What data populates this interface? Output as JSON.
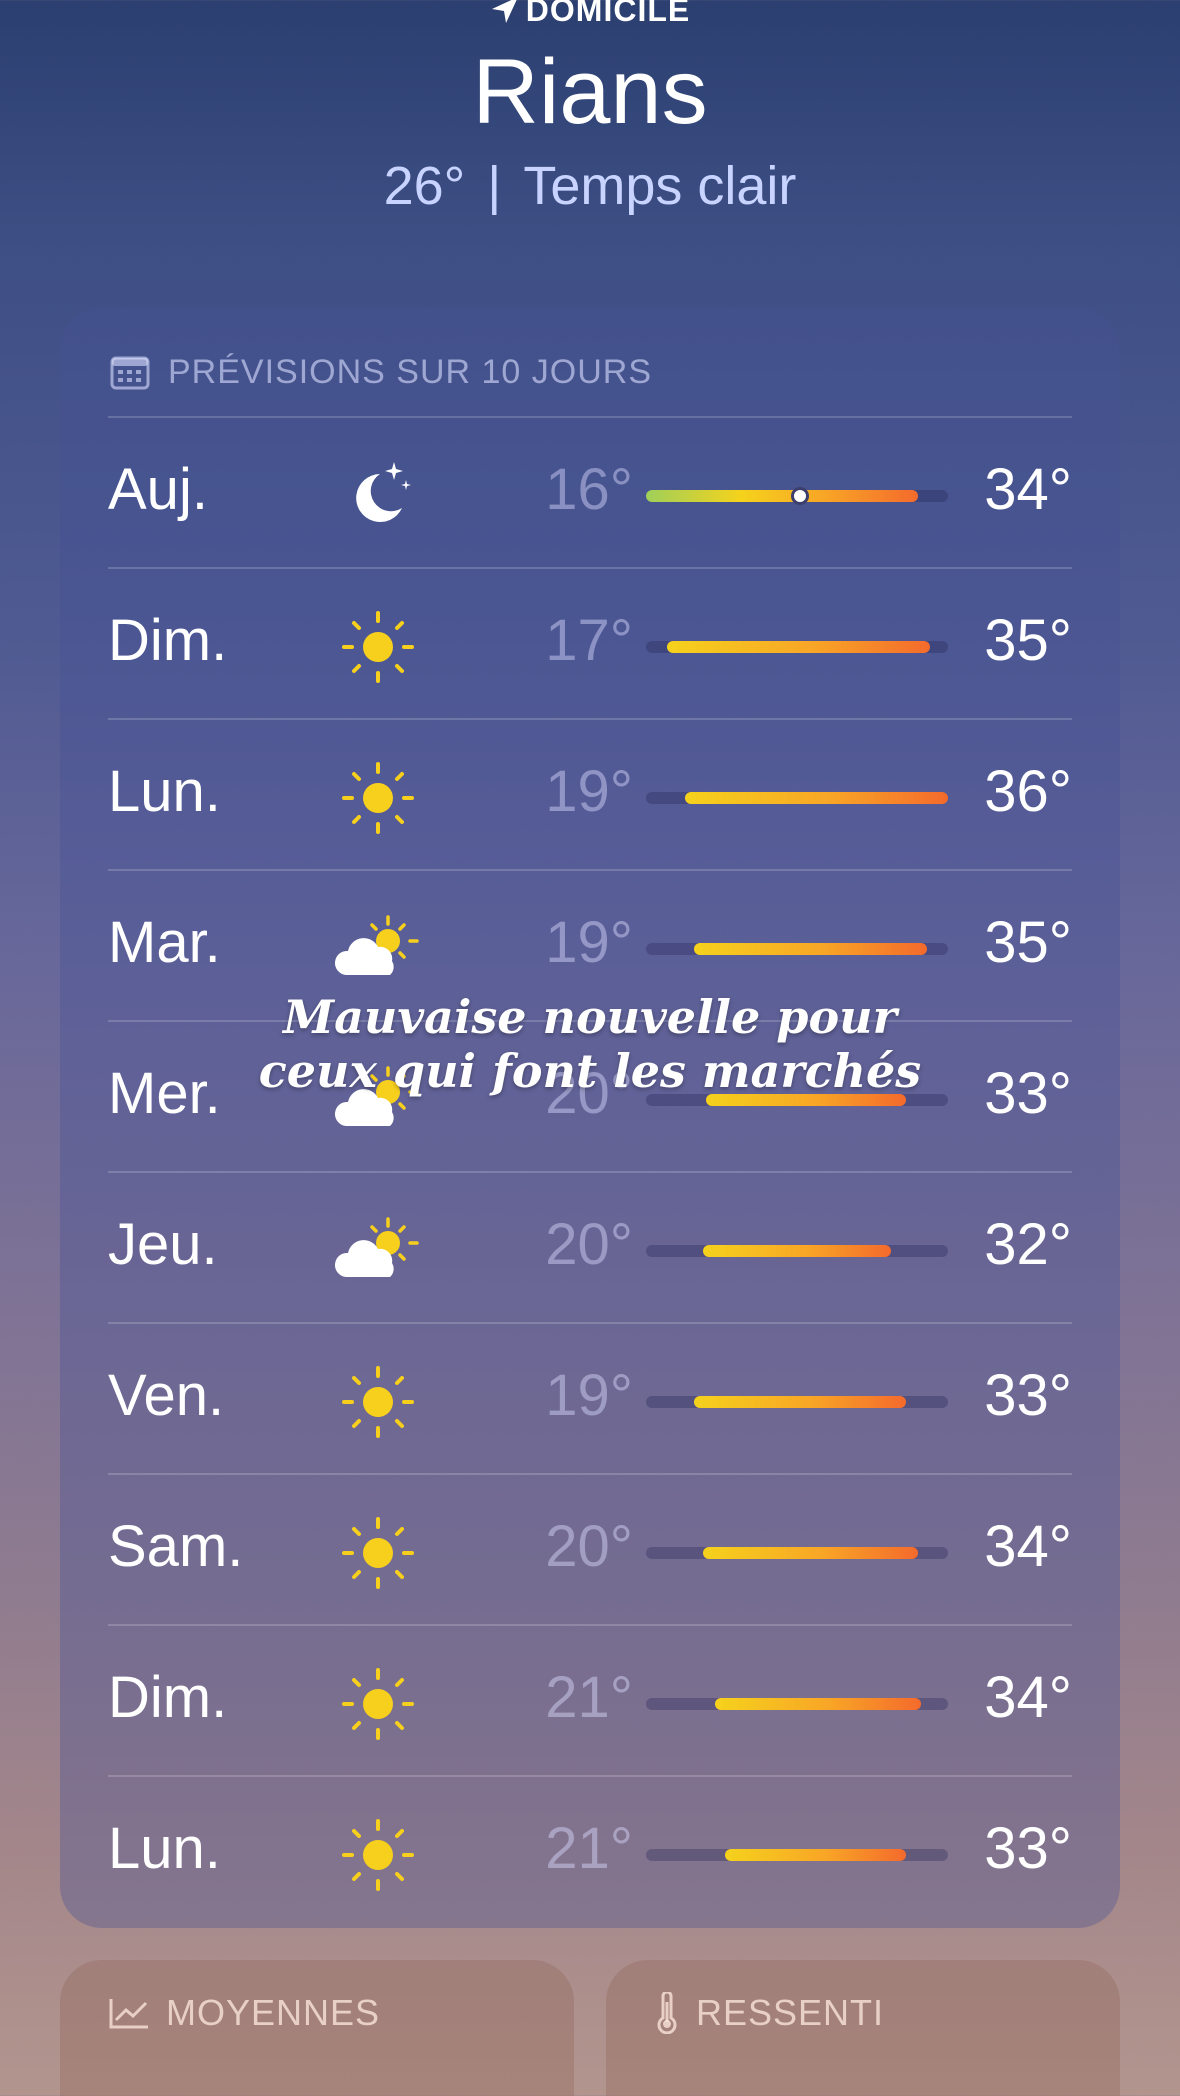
{
  "header": {
    "location_label": "DOMICILE",
    "city": "Rians",
    "current_temp": "26°",
    "separator": "|",
    "condition": "Temps clair"
  },
  "forecast": {
    "title": "PRÉVISIONS SUR 10 JOURS",
    "days": [
      {
        "day": "Auj.",
        "icon": "moon-stars-icon",
        "low": "16°",
        "high": "34°",
        "bar_start": 0.0,
        "bar_end": 0.9,
        "current_pos": 0.51
      },
      {
        "day": "Dim.",
        "icon": "sun-icon",
        "low": "17°",
        "high": "35°",
        "bar_start": 0.07,
        "bar_end": 0.94
      },
      {
        "day": "Lun.",
        "icon": "sun-icon",
        "low": "19°",
        "high": "36°",
        "bar_start": 0.13,
        "bar_end": 1.0
      },
      {
        "day": "Mar.",
        "icon": "partly-cloudy-icon",
        "low": "19°",
        "high": "35°",
        "bar_start": 0.16,
        "bar_end": 0.93
      },
      {
        "day": "Mer.",
        "icon": "partly-cloudy-icon",
        "low": "20°",
        "high": "33°",
        "bar_start": 0.2,
        "bar_end": 0.86
      },
      {
        "day": "Jeu.",
        "icon": "partly-cloudy-icon",
        "low": "20°",
        "high": "32°",
        "bar_start": 0.19,
        "bar_end": 0.81
      },
      {
        "day": "Ven.",
        "icon": "sun-icon",
        "low": "19°",
        "high": "33°",
        "bar_start": 0.16,
        "bar_end": 0.86
      },
      {
        "day": "Sam.",
        "icon": "sun-icon",
        "low": "20°",
        "high": "34°",
        "bar_start": 0.19,
        "bar_end": 0.9
      },
      {
        "day": "Dim.",
        "icon": "sun-icon",
        "low": "21°",
        "high": "34°",
        "bar_start": 0.23,
        "bar_end": 0.91
      },
      {
        "day": "Lun.",
        "icon": "sun-icon",
        "low": "21°",
        "high": "33°",
        "bar_start": 0.26,
        "bar_end": 0.86
      }
    ]
  },
  "overlay_caption": {
    "line1": "Mauvaise nouvelle pour",
    "line2": "ceux qui font les marchés"
  },
  "tiles": {
    "averages": "MOYENNES",
    "feels_like": "RESSENTI"
  },
  "colors": {
    "bar_start": "#f5d21c",
    "bar_end": "#f46a2c",
    "sun": "#f7cf1d"
  }
}
